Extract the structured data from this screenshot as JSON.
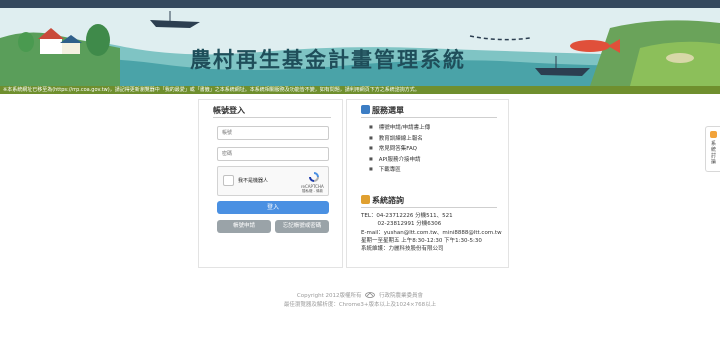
{
  "banner": {
    "title": "農村再生基金計畫管理系統"
  },
  "notice": "※本系統網址已移至為(https://rrp.coa.gov.tw)，請記得更新瀏覽器中「我的最愛」或「書籤」之本系統網址。本系統相關服務及功能皆不變，如有問題，請利用網頁下方之系統諮詢方式。",
  "side_tab": {
    "label": "系統討論"
  },
  "login": {
    "title": "帳號登入",
    "account_placeholder": "帳號",
    "password_placeholder": "密碼",
    "captcha_label": "我不是機器人",
    "captcha_brand": "reCAPTCHA",
    "captcha_links": "隱私權 - 條款",
    "login_button": "登入",
    "apply_button": "帳號申請",
    "forgot_button": "忘記帳號或密碼"
  },
  "services": {
    "title": "服務選單",
    "items": [
      "標號申請/申請書上傳",
      "教育訓練線上報名",
      "常見問答集FAQ",
      "API服務介接申請",
      "下載專區"
    ]
  },
  "consult": {
    "title": "系統諮詢",
    "lines": [
      "TEL：04-23712226 分機511、521",
      "　　　02-23812991 分機6306",
      "E-mail：yushan@ltt.com.tw、mini8888@ltt.com.tw",
      "星期一至星期五 上午8:30-12:30 下午1:30-5:30",
      "系統維護：力麗科技股份有限公司"
    ]
  },
  "footer": {
    "copyright_prefix": "Copyright 2012版權所有",
    "copyright_org": "行政院農業委員會",
    "browser_note": "最佳瀏覽器及解析度：Chrome3+版本以上及1024×768以上"
  },
  "colors": {
    "topbar": "#34495e",
    "notice_bar": "#6f8f2e",
    "login_button": "#4a90e2",
    "secondary_button": "#9aa3a8",
    "banner_bg": "#dfeef0"
  }
}
